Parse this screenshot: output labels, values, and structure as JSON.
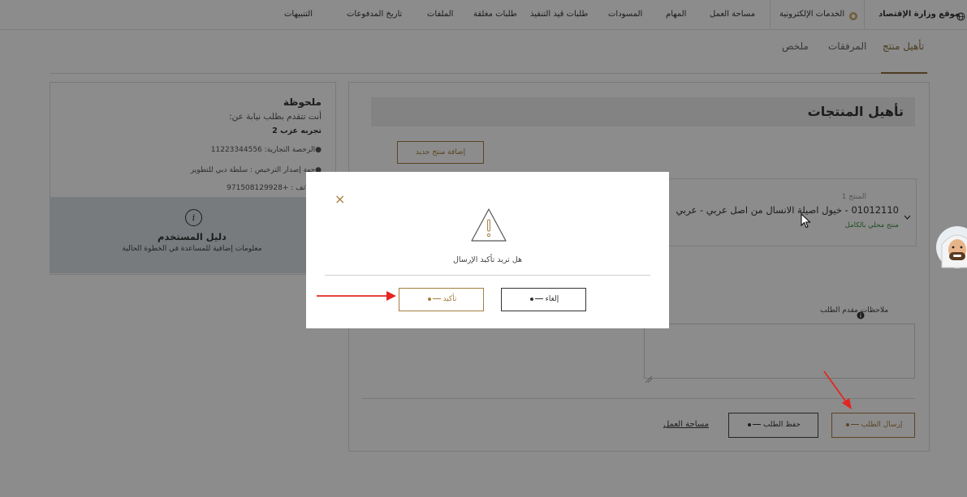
{
  "nav": {
    "items": [
      "موقع وزارة الإقتصاد",
      "الخدمات الإلكترونية",
      "مساحة العمل",
      "المهام",
      "المسودات",
      "طلبات قيد التنفيذ",
      "طلبات مغلقة",
      "الملفات",
      "تاريخ المدفوعات",
      "التنبيهات"
    ]
  },
  "tabs": [
    "تأهيل منتج",
    "المرفقات",
    "ملخص"
  ],
  "main": {
    "title": "تأهيل المنتجات",
    "add_product": "إضافة منتج جديد",
    "product_label": "المنتج 1",
    "product_name": "01012110 - خيول اصيلة الانسال من اصل عربي - عربي",
    "product_tag": "منتج محلي بالكامل",
    "notes_label": "ملاحظات مقدم الطلب",
    "send": "إرسال الطلب",
    "save": "حفظ الطلب",
    "workspace": "مساحة العمل"
  },
  "info": {
    "note_title": "ملحوظة",
    "on_behalf": "أنت تتقدم بطلب نيابة عن:",
    "company": "تجربه عزب 2",
    "license_label": "الرخصة التجارية:",
    "license_value": "11223344556",
    "authority_label": "جهة إصدار الترخيص :",
    "authority_value": "سلطة دبي للتطوير",
    "phone_label": "الهاتف :",
    "phone_value": "+971508129928",
    "guide_title": "دليل المستخدم",
    "guide_text": "معلومات إضافية للمساعدة في الخطوة الحالية",
    "info_symbol": "i"
  },
  "modal": {
    "question": "هل تريد تأكيد الإرسال",
    "confirm": "تأكيد",
    "cancel": "إلغاء",
    "close_symbol": "×",
    "warning_symbol": "!"
  },
  "colors": {
    "accent": "#a57e3e",
    "tab_active": "#8a6d3b",
    "guide_bg": "#d9e0e6",
    "arrow": "#e3261f",
    "product_tag": "#3c8f3c"
  }
}
